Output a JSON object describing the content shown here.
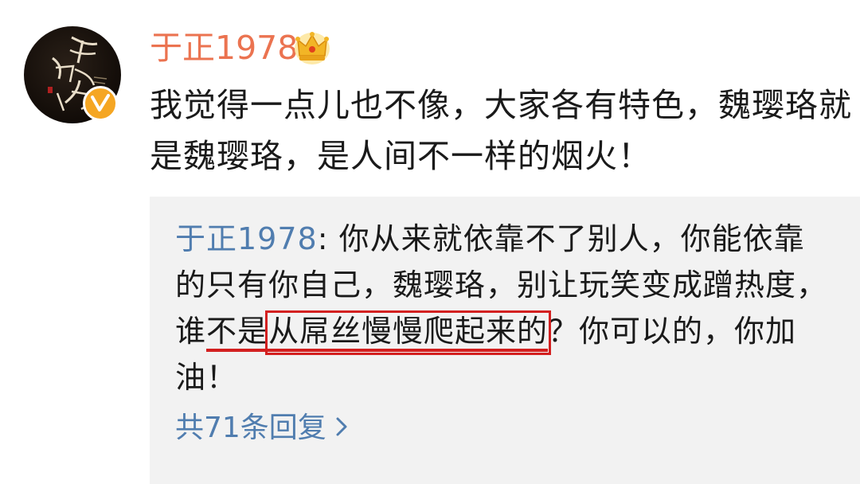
{
  "post": {
    "username": "于正1978",
    "badge_icon": "crown-icon",
    "verified_icon": "verified-v-icon",
    "text": "我觉得一点儿也不像，大家各有特色，魏璎珞就是魏璎珞，是人间不一样的烟火！"
  },
  "reply": {
    "author": "于正1978",
    "separator": ": ",
    "text_before": "你从来就依靠不了别人，你能依靠的只有你自己，魏璎珞，别让玩笑变成蹭热度，谁",
    "text_underlined": "不是",
    "text_highlighted": "从屌丝慢慢爬起来的",
    "text_after": "？你可以的，你加油！",
    "count_label": "共71条回复",
    "count_icon": "chevron-right-icon"
  },
  "colors": {
    "username": "#eb7350",
    "link": "#507daf",
    "highlight": "#d32020",
    "reply_bg": "#f2f2f2"
  }
}
